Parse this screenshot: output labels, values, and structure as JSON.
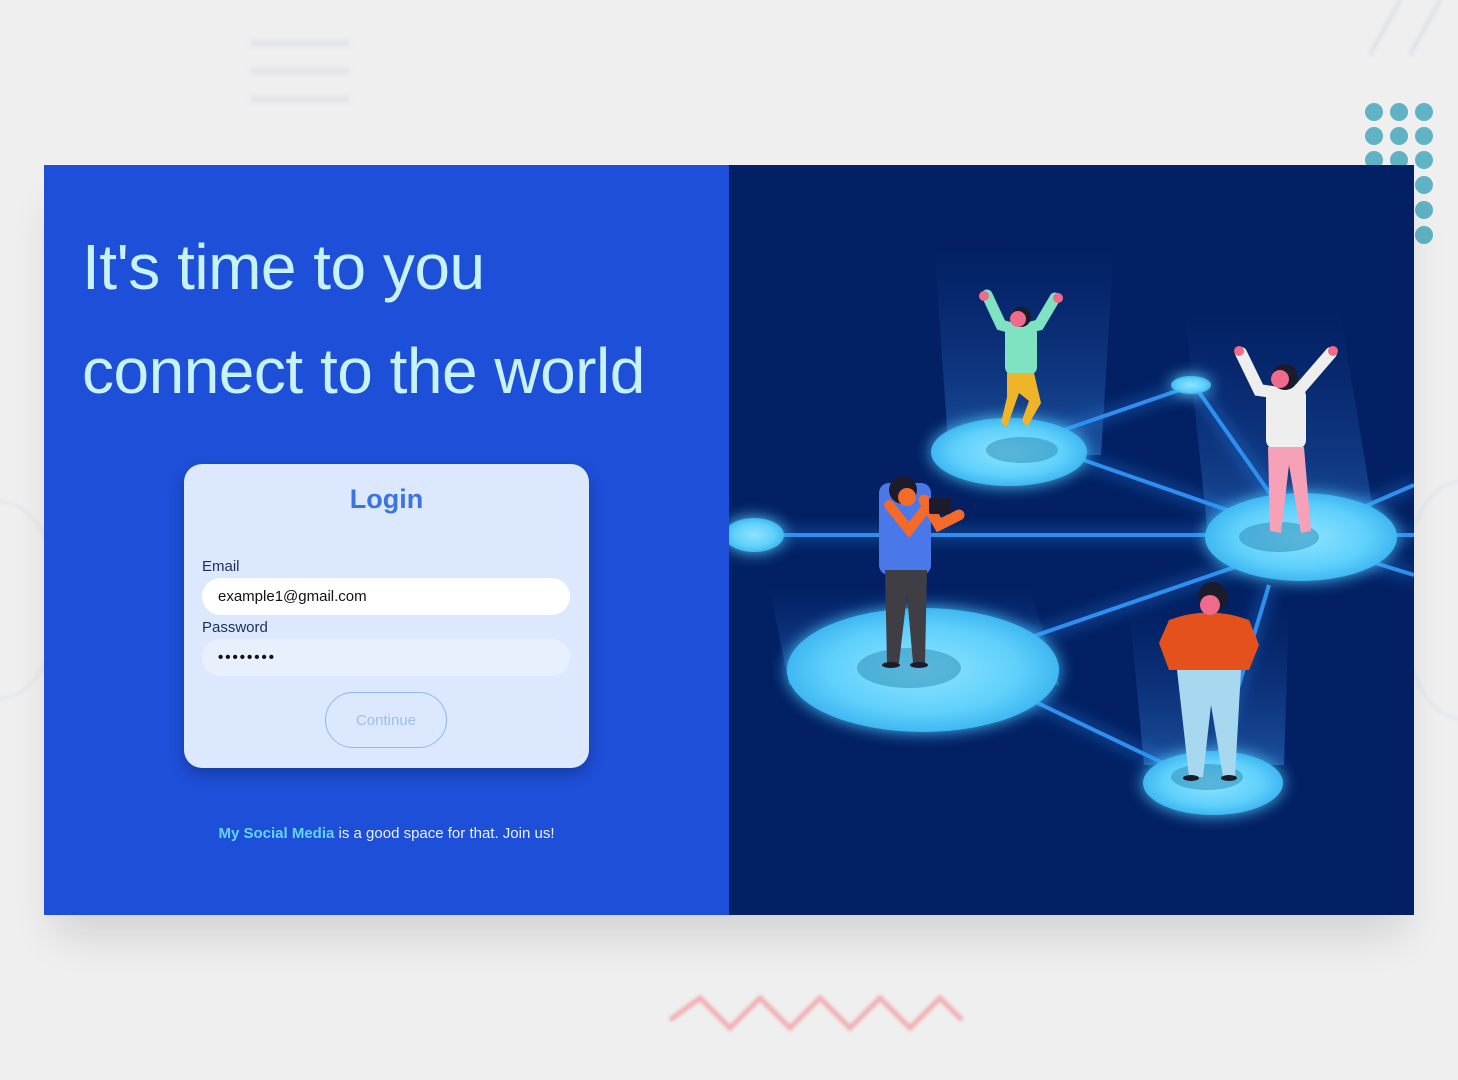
{
  "hero": {
    "line1": "It's time to you",
    "line2": "connect to the world"
  },
  "login": {
    "title": "Login",
    "email_label": "Email",
    "email_value": "example1@gmail.com",
    "password_label": "Password",
    "password_value": "••••••••",
    "continue_label": "Continue"
  },
  "footer": {
    "brand": "My Social Media",
    "text": " is a good space for that. Join us!"
  },
  "colors": {
    "left_panel": "#1e4fd8",
    "right_panel": "#022063",
    "headline": "#c6f3f7",
    "accent": "#3a74e0",
    "brand": "#63d6f5"
  }
}
